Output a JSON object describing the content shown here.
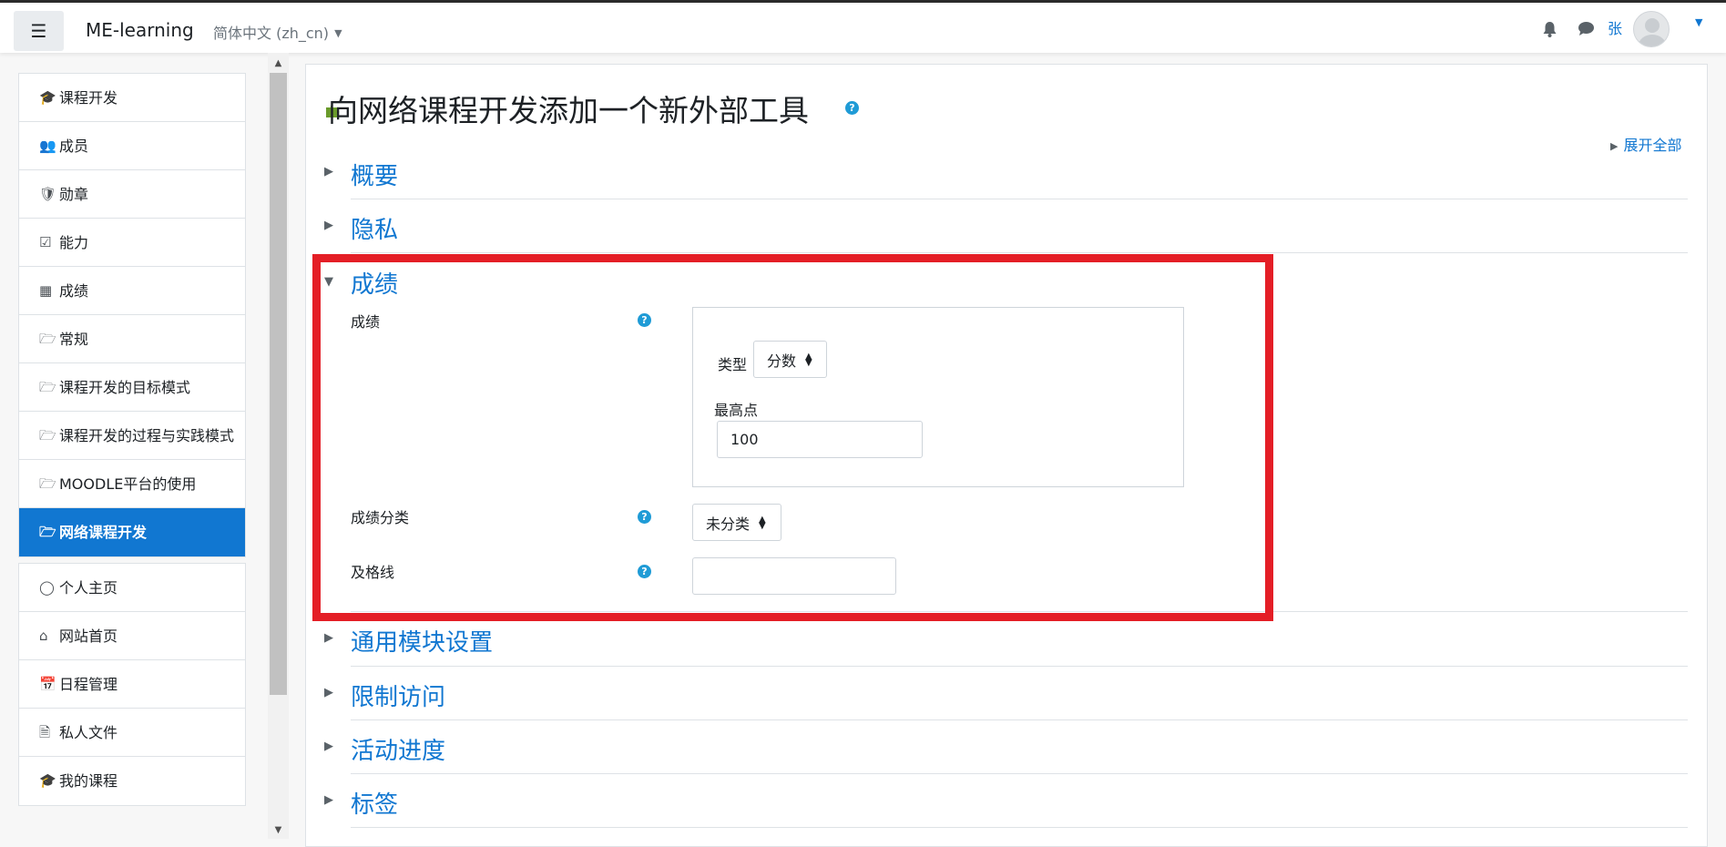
{
  "navbar": {
    "menu_icon": "hamburger-icon",
    "brand": "ME-learning",
    "language": "简体中文 (zh_cn)",
    "user_initial": "张"
  },
  "sidebar": {
    "course_items": [
      {
        "icon": "graduation-cap-icon",
        "label": "课程开发"
      },
      {
        "icon": "users-icon",
        "label": "成员"
      },
      {
        "icon": "shield-icon",
        "label": "勋章"
      },
      {
        "icon": "check-square-icon",
        "label": "能力"
      },
      {
        "icon": "table-icon",
        "label": "成绩"
      },
      {
        "icon": "folder-icon",
        "label": "常规"
      },
      {
        "icon": "folder-icon",
        "label": "课程开发的目标模式"
      },
      {
        "icon": "folder-icon",
        "label": "课程开发的过程与实践模式"
      },
      {
        "icon": "folder-icon",
        "label": "MOODLE平台的使用"
      },
      {
        "icon": "folder-icon",
        "label": "网络课程开发",
        "active": true
      }
    ],
    "site_items": [
      {
        "icon": "dashboard-icon",
        "label": "个人主页"
      },
      {
        "icon": "home-icon",
        "label": "网站首页"
      },
      {
        "icon": "calendar-icon",
        "label": "日程管理"
      },
      {
        "icon": "file-icon",
        "label": "私人文件"
      },
      {
        "icon": "graduation-cap-icon",
        "label": "我的课程"
      }
    ]
  },
  "main": {
    "title": "向网络课程开发添加一个新外部工具",
    "expand_all": "展开全部",
    "sections": {
      "general": "概要",
      "privacy": "隐私",
      "grade": "成绩",
      "common_module": "通用模块设置",
      "restrict": "限制访问",
      "completion": "活动进度",
      "tags": "标签"
    },
    "grade_form": {
      "grade_label": "成绩",
      "type_label": "类型",
      "type_value": "分数",
      "max_label": "最高点",
      "max_value": "100",
      "category_label": "成绩分类",
      "category_value": "未分类",
      "pass_label": "及格线",
      "pass_value": ""
    }
  },
  "colors": {
    "accent": "#1177d1",
    "highlight": "#e41e26"
  }
}
